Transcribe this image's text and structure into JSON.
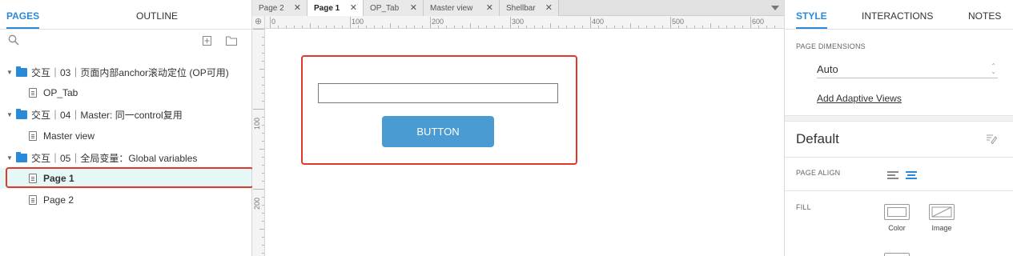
{
  "left_panel": {
    "tabs": [
      "PAGES",
      "OUTLINE"
    ],
    "pages": [
      {
        "type": "folder",
        "label": "交互｜03｜页面内部anchor滚动定位 (OP可用)"
      },
      {
        "type": "page",
        "label": "OP_Tab"
      },
      {
        "type": "folder",
        "label": "交互｜04｜Master: 同一control复用"
      },
      {
        "type": "page",
        "label": "Master view"
      },
      {
        "type": "folder",
        "label": "交互｜05｜全局变量：Global variables"
      },
      {
        "type": "page",
        "label": "Page 1",
        "selected": true
      },
      {
        "type": "page",
        "label": "Page 2"
      }
    ],
    "icons": {
      "search": "search-icon",
      "add_page": "add-page-icon",
      "add_folder": "add-folder-icon"
    }
  },
  "document_tabs": [
    {
      "label": "Page 2",
      "active": false
    },
    {
      "label": "Page 1",
      "active": true
    },
    {
      "label": "OP_Tab",
      "active": false
    },
    {
      "label": "Master view",
      "active": false
    },
    {
      "label": "Shellbar",
      "active": false
    }
  ],
  "ruler": {
    "h_labels": [
      "0",
      "100",
      "200",
      "300",
      "400",
      "500",
      "600"
    ],
    "v_labels": [
      "100",
      "200"
    ]
  },
  "canvas": {
    "button_label": "BUTTON",
    "textfield_value": ""
  },
  "right_panel": {
    "tabs": [
      "STYLE",
      "INTERACTIONS",
      "NOTES"
    ],
    "page_dimensions_label": "PAGE DIMENSIONS",
    "page_dimensions_value": "Auto",
    "add_adaptive_views": "Add Adaptive Views",
    "style_name": "Default",
    "page_align_label": "PAGE ALIGN",
    "page_align_selected": "center",
    "fill_label": "FILL",
    "fill_options": [
      "Color",
      "Image"
    ]
  },
  "colors": {
    "accent": "#2a8ad8",
    "annotation_red": "#e0382b",
    "button_blue": "#4b9bd3",
    "selected_row": "#e6f8f6"
  }
}
